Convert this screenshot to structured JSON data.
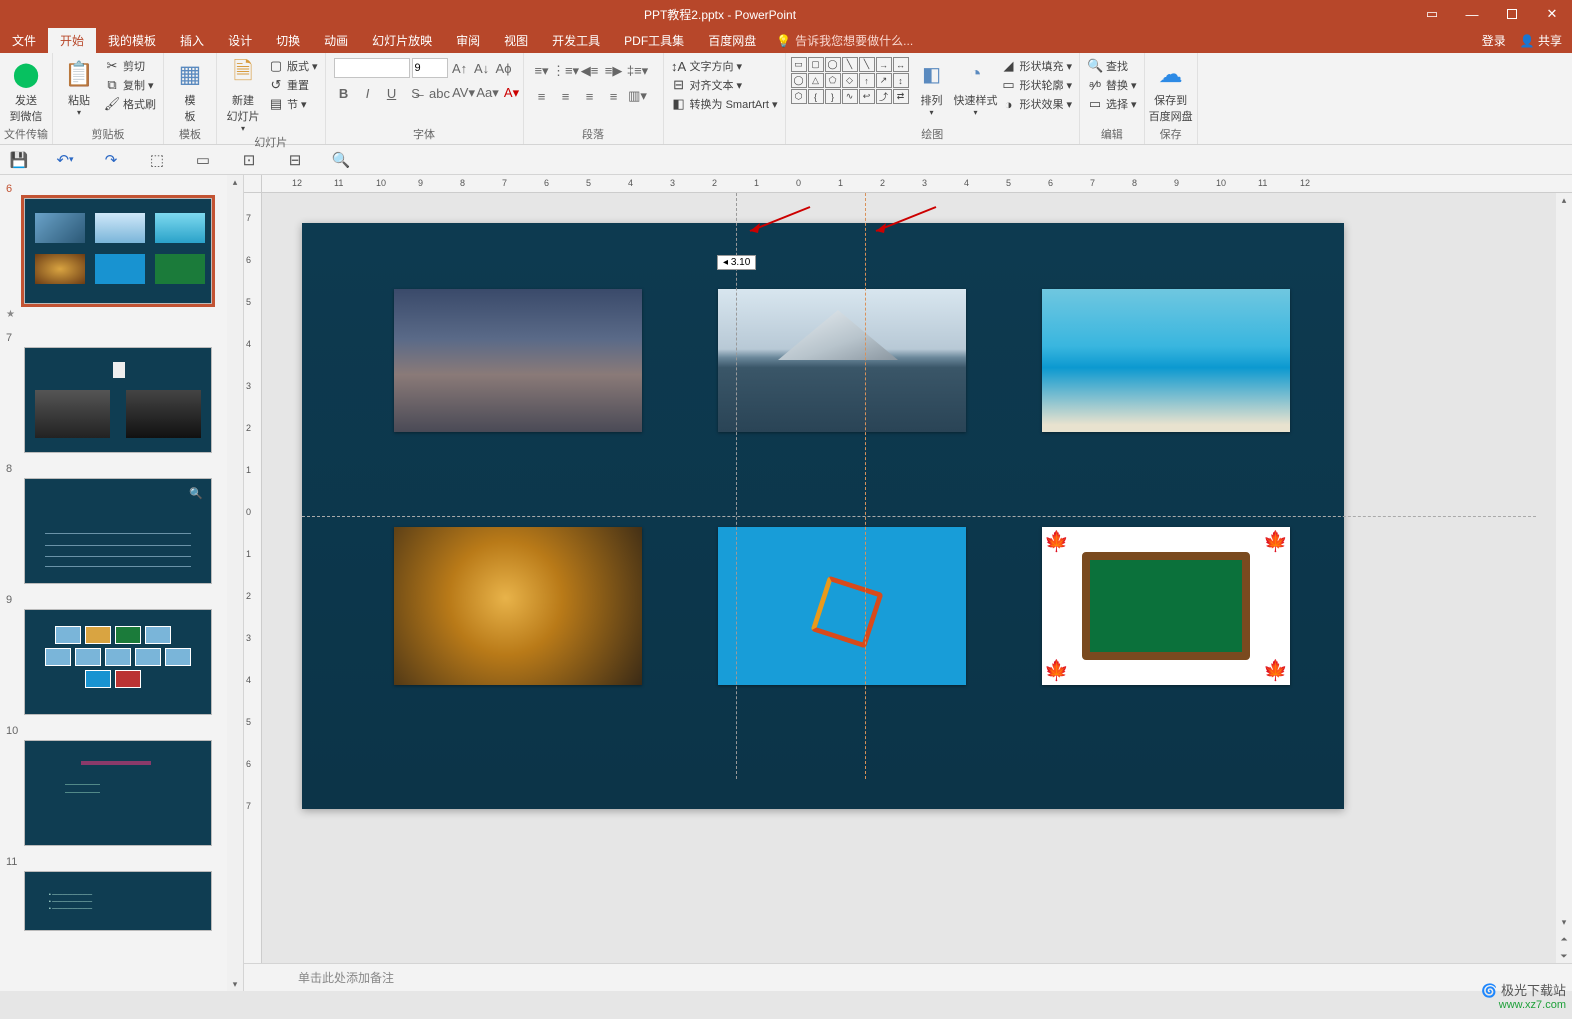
{
  "window": {
    "title": "PPT教程2.pptx - PowerPoint"
  },
  "menubar": {
    "tabs": [
      "文件",
      "开始",
      "我的模板",
      "插入",
      "设计",
      "切换",
      "动画",
      "幻灯片放映",
      "审阅",
      "视图",
      "开发工具",
      "PDF工具集",
      "百度网盘"
    ],
    "active_index": 1,
    "tell_me": "告诉我您想要做什么...",
    "login": "登录",
    "share": "共享"
  },
  "ribbon": {
    "group_file_transfer": {
      "label": "文件传输",
      "send_wechat": "发送\n到微信"
    },
    "group_clipboard": {
      "label": "剪贴板",
      "paste": "粘贴",
      "cut": "剪切",
      "copy": "复制",
      "format_painter": "格式刷"
    },
    "group_templates": {
      "label": "模板",
      "templates": "模\n板"
    },
    "group_slides": {
      "label": "幻灯片",
      "new_slide": "新建\n幻灯片",
      "layout": "版式",
      "reset": "重置",
      "section": "节"
    },
    "group_font": {
      "label": "字体",
      "size": "9"
    },
    "group_paragraph": {
      "label": "段落",
      "text_direction": "文字方向",
      "align_text": "对齐文本",
      "smartart": "转换为 SmartArt"
    },
    "group_drawing": {
      "label": "绘图",
      "arrange": "排列",
      "quick_styles": "快速样式",
      "shape_fill": "形状填充",
      "shape_outline": "形状轮廓",
      "shape_effects": "形状效果"
    },
    "group_editing": {
      "label": "编辑",
      "find": "查找",
      "replace": "替换",
      "select": "选择"
    },
    "group_save": {
      "label": "保存",
      "save_to": "保存到\n百度网盘"
    }
  },
  "slide_panel": {
    "numbers": [
      "6",
      "7",
      "8",
      "9",
      "10",
      "11"
    ],
    "active_slide": 6
  },
  "canvas": {
    "guide_label": "3.10"
  },
  "ruler": {
    "h": [
      "12",
      "11",
      "10",
      "9",
      "8",
      "7",
      "6",
      "5",
      "4",
      "3",
      "2",
      "1",
      "0",
      "1",
      "2",
      "3",
      "4",
      "5",
      "6",
      "7",
      "8",
      "9",
      "10",
      "11",
      "12"
    ],
    "v": [
      "7",
      "6",
      "5",
      "4",
      "3",
      "2",
      "1",
      "0",
      "1",
      "2",
      "3",
      "4",
      "5",
      "6",
      "7"
    ]
  },
  "notes": {
    "placeholder": "单击此处添加备注"
  },
  "watermark": {
    "brand": "极光下载站",
    "url": "www.xz7.com"
  }
}
